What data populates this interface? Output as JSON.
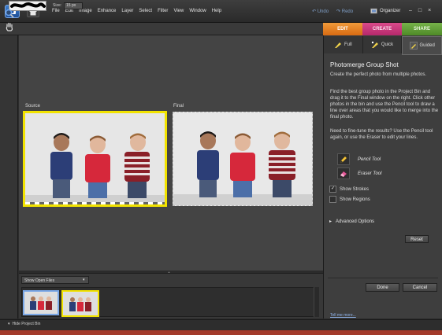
{
  "menu_items": [
    "File",
    "Edit",
    "Image",
    "Enhance",
    "Layer",
    "Select",
    "Filter",
    "View",
    "Window",
    "Help"
  ],
  "toolbar": {
    "undo_label": "Undo",
    "redo_label": "Redo",
    "organizer_label": "Organizer"
  },
  "window_controls": {
    "minimize": "–",
    "maximize": "□",
    "close": "×"
  },
  "options": {
    "size_label": "Size:",
    "size_value": "15 px"
  },
  "mode_tabs": {
    "edit": "EDIT",
    "create": "CREATE",
    "share": "SHARE"
  },
  "canvas": {
    "source_label": "Source",
    "final_label": "Final"
  },
  "bin": {
    "dropdown_value": "Show Open Files",
    "hide_label": "Hide Project Bin"
  },
  "panel": {
    "tabs": [
      "Full",
      "Quick",
      "Guided"
    ],
    "title": "Photomerge Group Shot",
    "text1": "Create the perfect photo from multiple photos.",
    "text2": "Find the best group photo in the Project Bin and drag it to the Final window on the right. Click other photos in the bin and use the Pencil tool to draw a line over areas that you would like to merge into the final photo.",
    "text3": "Need to fine-tune the results? Use the Pencil tool again, or use the Eraser to edit your lines.",
    "pencil_label": "Pencil Tool",
    "eraser_label": "Eraser Tool",
    "show_strokes": "Show Strokes",
    "show_regions": "Show Regions",
    "advanced_options": "Advanced Options",
    "reset": "Reset",
    "done": "Done",
    "cancel": "Cancel",
    "tell_more": "Tell me more..."
  },
  "colors": {
    "edit_tab": "#e47c1e",
    "create_tab": "#c8377a",
    "share_tab": "#5f9c35",
    "source_border": "#f2e300",
    "thumb_selected": "#7aa7e6"
  }
}
